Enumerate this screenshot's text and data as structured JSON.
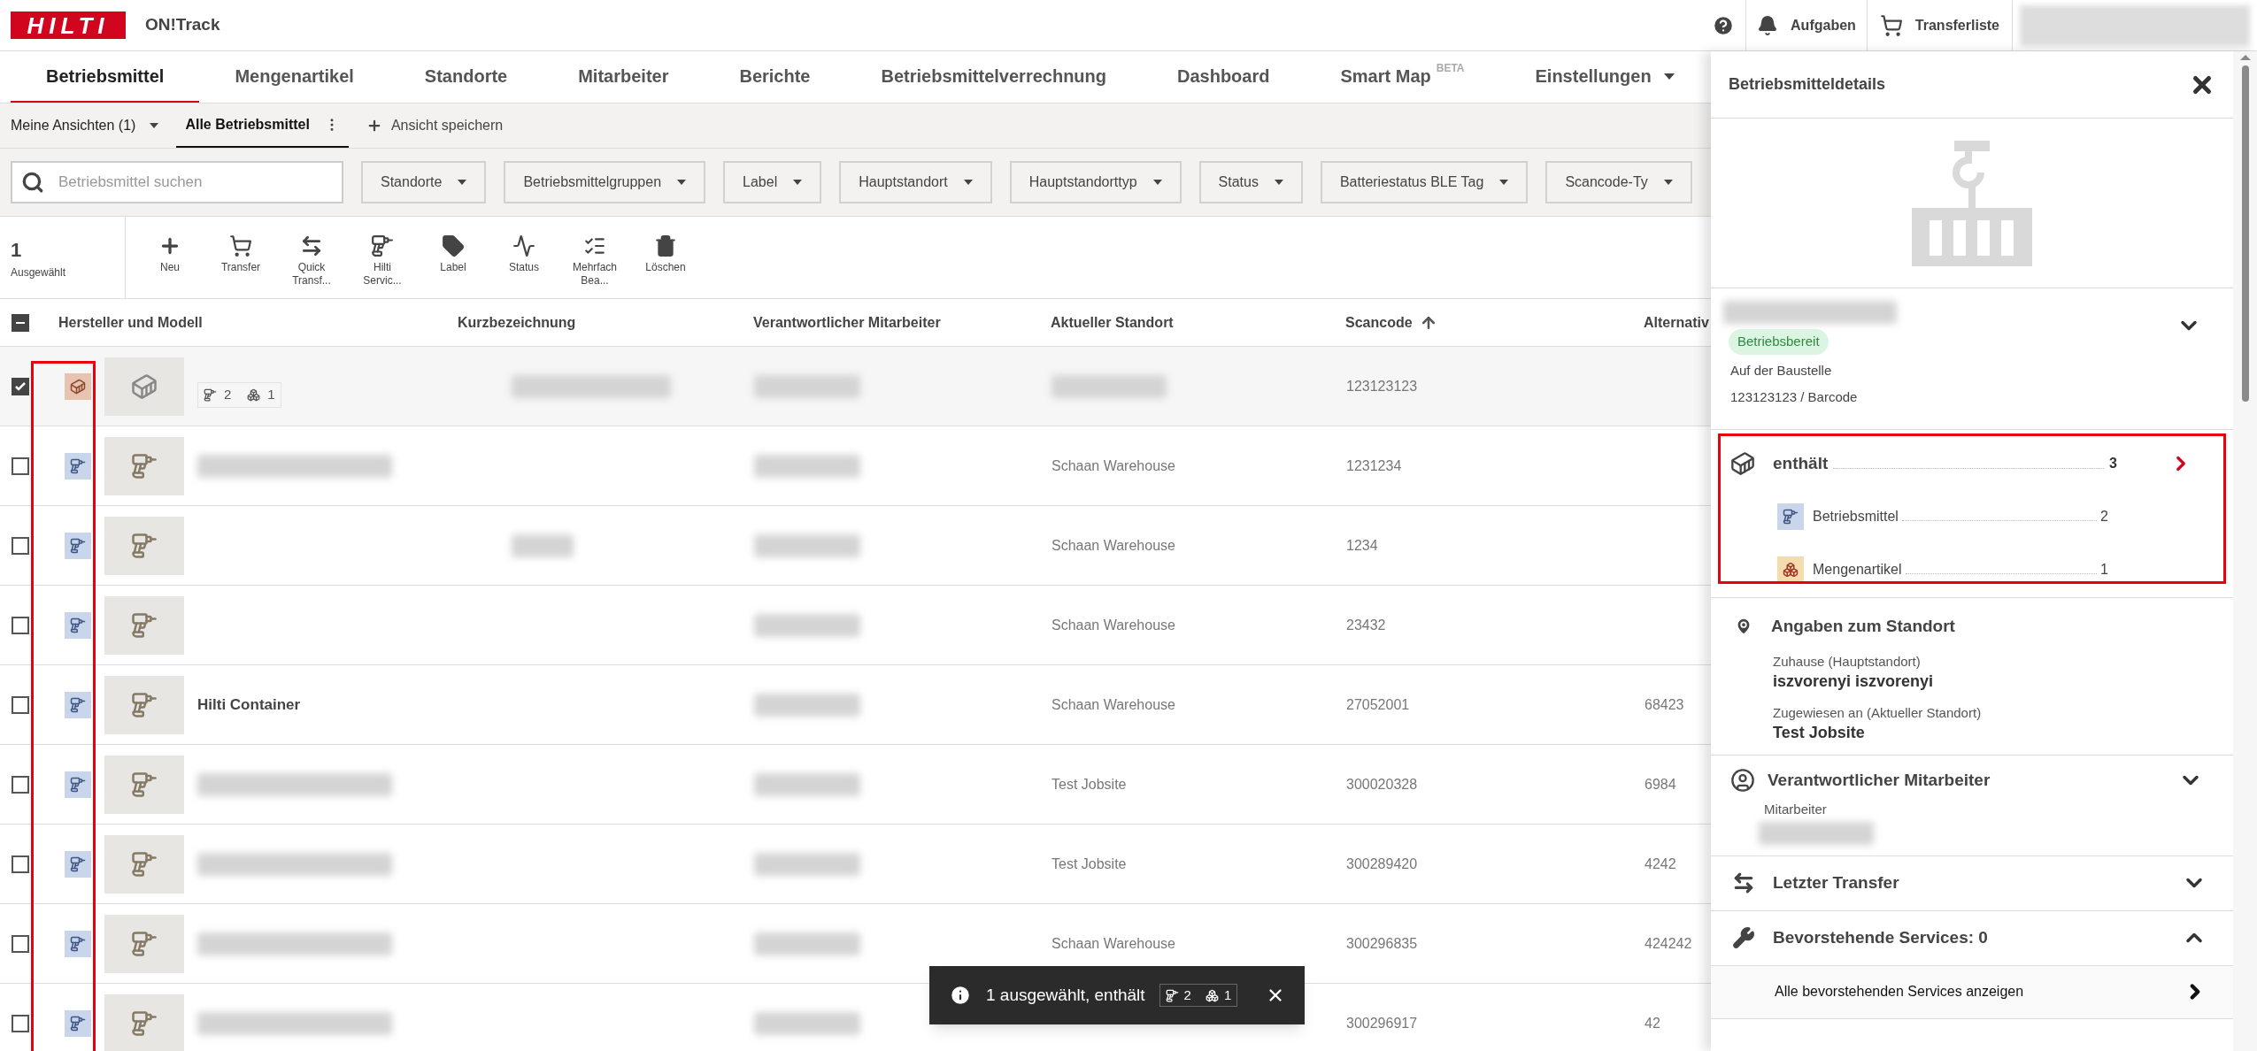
{
  "header": {
    "logo_text": "HILTI",
    "app_name": "ON!Track",
    "actions": [
      {
        "kind": "help"
      },
      {
        "kind": "tasks",
        "label": "Aufgaben"
      },
      {
        "kind": "transfer",
        "label": "Transferliste"
      },
      {
        "kind": "user"
      }
    ]
  },
  "nav": [
    {
      "label": "Betriebsmittel",
      "selected": true
    },
    {
      "label": "Mengenartikel",
      "selected": false
    },
    {
      "label": "Standorte",
      "selected": false
    },
    {
      "label": "Mitarbeiter",
      "selected": false
    },
    {
      "label": "Berichte",
      "selected": false
    },
    {
      "label": "Betriebsmittelverrechnung",
      "selected": false
    },
    {
      "label": "Dashboard",
      "selected": false
    },
    {
      "label": "Smart Map",
      "badge": "BETA",
      "selected": false
    },
    {
      "label": "Einstellungen",
      "dropdown": true,
      "selected": false
    }
  ],
  "views": {
    "menu": "Meine Ansichten (1)",
    "current": "Alle Betriebsmittel",
    "save": "Ansicht speichern"
  },
  "search": {
    "placeholder": "Betriebsmittel suchen"
  },
  "filters": [
    "Standorte",
    "Betriebsmittelgruppen",
    "Label",
    "Hauptstandort",
    "Hauptstandorttyp",
    "Status",
    "Batteriestatus BLE Tag",
    "Scancode-Ty"
  ],
  "toolbar": {
    "count": "1",
    "count_label": "Ausgewählt",
    "actions": [
      {
        "kind": "new",
        "label": "Neu"
      },
      {
        "kind": "transfer",
        "label": "Transfer"
      },
      {
        "kind": "quick",
        "label": "Quick Transf..."
      },
      {
        "kind": "service",
        "label": "Hilti Servic..."
      },
      {
        "kind": "label",
        "label": "Label"
      },
      {
        "kind": "status",
        "label": "Status"
      },
      {
        "kind": "multi",
        "label": "Mehrfach Bea..."
      },
      {
        "kind": "delete",
        "label": "Löschen"
      }
    ]
  },
  "table": {
    "select_all_partial": true,
    "type_column_highlighted": true,
    "columns": [
      {
        "label": "Hersteller und Modell"
      },
      {
        "label": "Kurzbezeichnung"
      },
      {
        "label": "Verantwortlicher Mitarbeiter"
      },
      {
        "label": "Aktueller Standort"
      },
      {
        "label": "Scancode",
        "sorted_ascending": true
      },
      {
        "label": "Alternativ"
      }
    ],
    "rows": [
      {
        "selected": true,
        "kind": "container",
        "counts": {
          "tools": "2",
          "items": "1"
        },
        "blurred": {
          "short": true,
          "employee": true,
          "location": true
        },
        "scancode": "123123123"
      },
      {
        "selected": false,
        "kind": "tool",
        "blurred": {
          "name": true,
          "employee": true
        },
        "location": "Schaan Warehouse",
        "scancode": "1231234"
      },
      {
        "selected": false,
        "kind": "tool",
        "blurred": {
          "short": true,
          "employee": true
        },
        "location": "Schaan Warehouse",
        "scancode": "1234"
      },
      {
        "selected": false,
        "kind": "tool",
        "blurred": {
          "employee": true
        },
        "location": "Schaan Warehouse",
        "scancode": "23432"
      },
      {
        "selected": false,
        "kind": "tool",
        "name": "Hilti Container",
        "blurred": {
          "employee": true
        },
        "location": "Schaan Warehouse",
        "scancode": "27052001",
        "alt": "68423"
      },
      {
        "selected": false,
        "kind": "tool",
        "blurred": {
          "name": true,
          "employee": true
        },
        "location": "Test Jobsite",
        "scancode": "300020328",
        "alt": "6984"
      },
      {
        "selected": false,
        "kind": "tool",
        "blurred": {
          "name": true,
          "employee": true
        },
        "location": "Test Jobsite",
        "scancode": "300289420",
        "alt": "4242"
      },
      {
        "selected": false,
        "kind": "tool",
        "blurred": {
          "name": true,
          "employee": true
        },
        "location": "Schaan Warehouse",
        "scancode": "300296835",
        "alt": "424242"
      },
      {
        "selected": false,
        "kind": "tool",
        "blurred": {
          "name": true,
          "employee": true
        },
        "scancode": "300296917",
        "alt": "42"
      }
    ]
  },
  "toast": {
    "text": "1 ausgewählt, enthält",
    "tools": "2",
    "items": "1"
  },
  "panel": {
    "title": "Betriebsmitteldetails",
    "summary": {
      "expanded": false,
      "blurred_name": true,
      "status": "Betriebsbereit",
      "color": "#2e8b3e",
      "lines": [
        "Auf der Baustelle",
        "123123123 / Barcode"
      ]
    },
    "contents": {
      "highlighted": true,
      "title": "enthält",
      "count": "3",
      "items": [
        {
          "kind": "tool",
          "label": "Betriebsmittel",
          "count": "2"
        },
        {
          "kind": "material",
          "label": "Mengenartikel",
          "count": "1"
        }
      ]
    },
    "sections": [
      {
        "kind": "location",
        "title": "Angaben zum Standort",
        "fields": [
          {
            "label": "Zuhause (Hauptstandort)",
            "value": "iszvorenyi iszvorenyi"
          },
          {
            "label": "Zugewiesen an (Aktueller Standort)",
            "value": "Test Jobsite"
          }
        ]
      },
      {
        "kind": "employee",
        "title": "Verantwortlicher Mitarbeiter",
        "expanded": false,
        "field_label": "Mitarbeiter",
        "blurred_value": true
      },
      {
        "kind": "transfer",
        "title": "Letzter Transfer",
        "expanded": false
      },
      {
        "kind": "service",
        "title": "Bevorstehende Services: 0",
        "expanded": true,
        "link": "Alle bevorstehenden Services anzeigen"
      }
    ]
  }
}
